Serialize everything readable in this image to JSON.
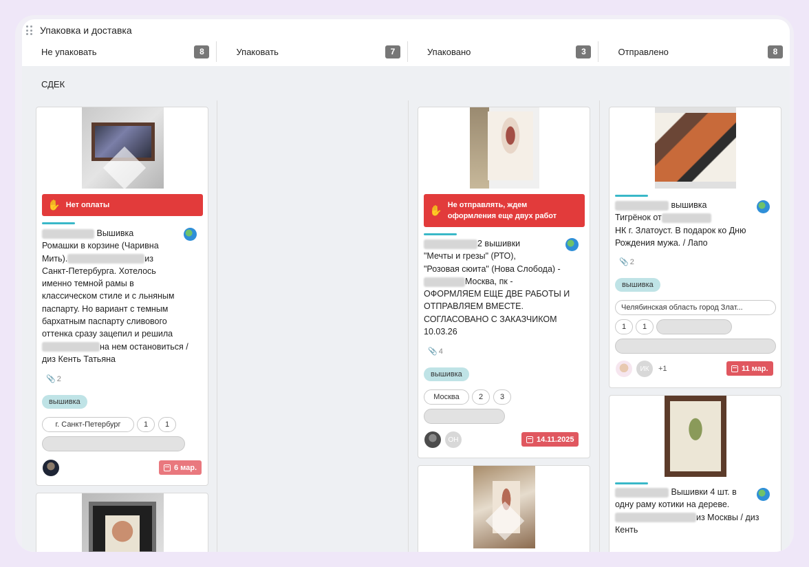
{
  "board": {
    "title": "Упаковка и доставка"
  },
  "columns": [
    {
      "title": "Не упаковать",
      "count": "8"
    },
    {
      "title": "Упаковать",
      "count": "7"
    },
    {
      "title": "Упаковано",
      "count": "3"
    },
    {
      "title": "Отправлено",
      "count": "8"
    }
  ],
  "swimlane": {
    "title": "СДЕК"
  },
  "cards": {
    "c1": {
      "alert": "Нет оплаты",
      "text_lines": [
        "Вышивка",
        "Ромашки в корзине (Чаривна",
        "Мить).",
        "из",
        "Санкт-Петербурга. Хотелось",
        "именно темной рамы в",
        "классическом стиле и с льняным",
        "паспарту. Но вариант с темным",
        "бархатным паспарту сливового",
        "оттенка сразу зацепил и решила",
        "на нем остановиться /",
        "диз Кенть Татьяна"
      ],
      "attachments": "2",
      "tag": "вышивка",
      "pills": [
        "г. Санкт-Петербург",
        "1",
        "1"
      ],
      "date": "6 мар."
    },
    "c3": {
      "alert_line1": "Не отправлять, ждем",
      "alert_line2": "оформления еще двух работ",
      "text_lines": [
        "2 вышивки",
        "\"Мечты и грезы\" (РТО),",
        "\"Розовая сюита\" (Нова Слобода) -",
        "Москва, пк -",
        "ОФОРМЛЯЕМ ЕЩЕ ДВЕ РАБОТЫ И",
        "ОТПРАВЛЯЕМ ВМЕСТЕ.",
        "СОГЛАСОВАНО С ЗАКАЗЧИКОМ",
        "10.03.26"
      ],
      "attachments": "4",
      "tag": "вышивка",
      "pills": [
        "Москва",
        "2",
        "3"
      ],
      "avatar2": "ОН",
      "date": "14.11.2025"
    },
    "c4": {
      "text_lines": [
        "вышивка",
        "Тигрёнок от",
        "НК г. Златоуст. В подарок ко Дню",
        "Рождения мужа. / Лапо"
      ],
      "attachments": "2",
      "tag": "вышивка",
      "pills": [
        "Челябинская область город Злат...",
        "1",
        "1"
      ],
      "avatar2": "ИК",
      "more": "+1",
      "date": "11 мар."
    },
    "c5": {
      "text_lines": [
        "Вышивки 4 шт. в",
        "одну раму котики на дереве.",
        "из Москвы / диз",
        "Кенть"
      ]
    }
  },
  "colors": {
    "alert": "#e23b3b",
    "date": "#e0575f",
    "tag": "#bfe3e6",
    "teal": "#39b8c8",
    "lane": "#eef0f3"
  }
}
